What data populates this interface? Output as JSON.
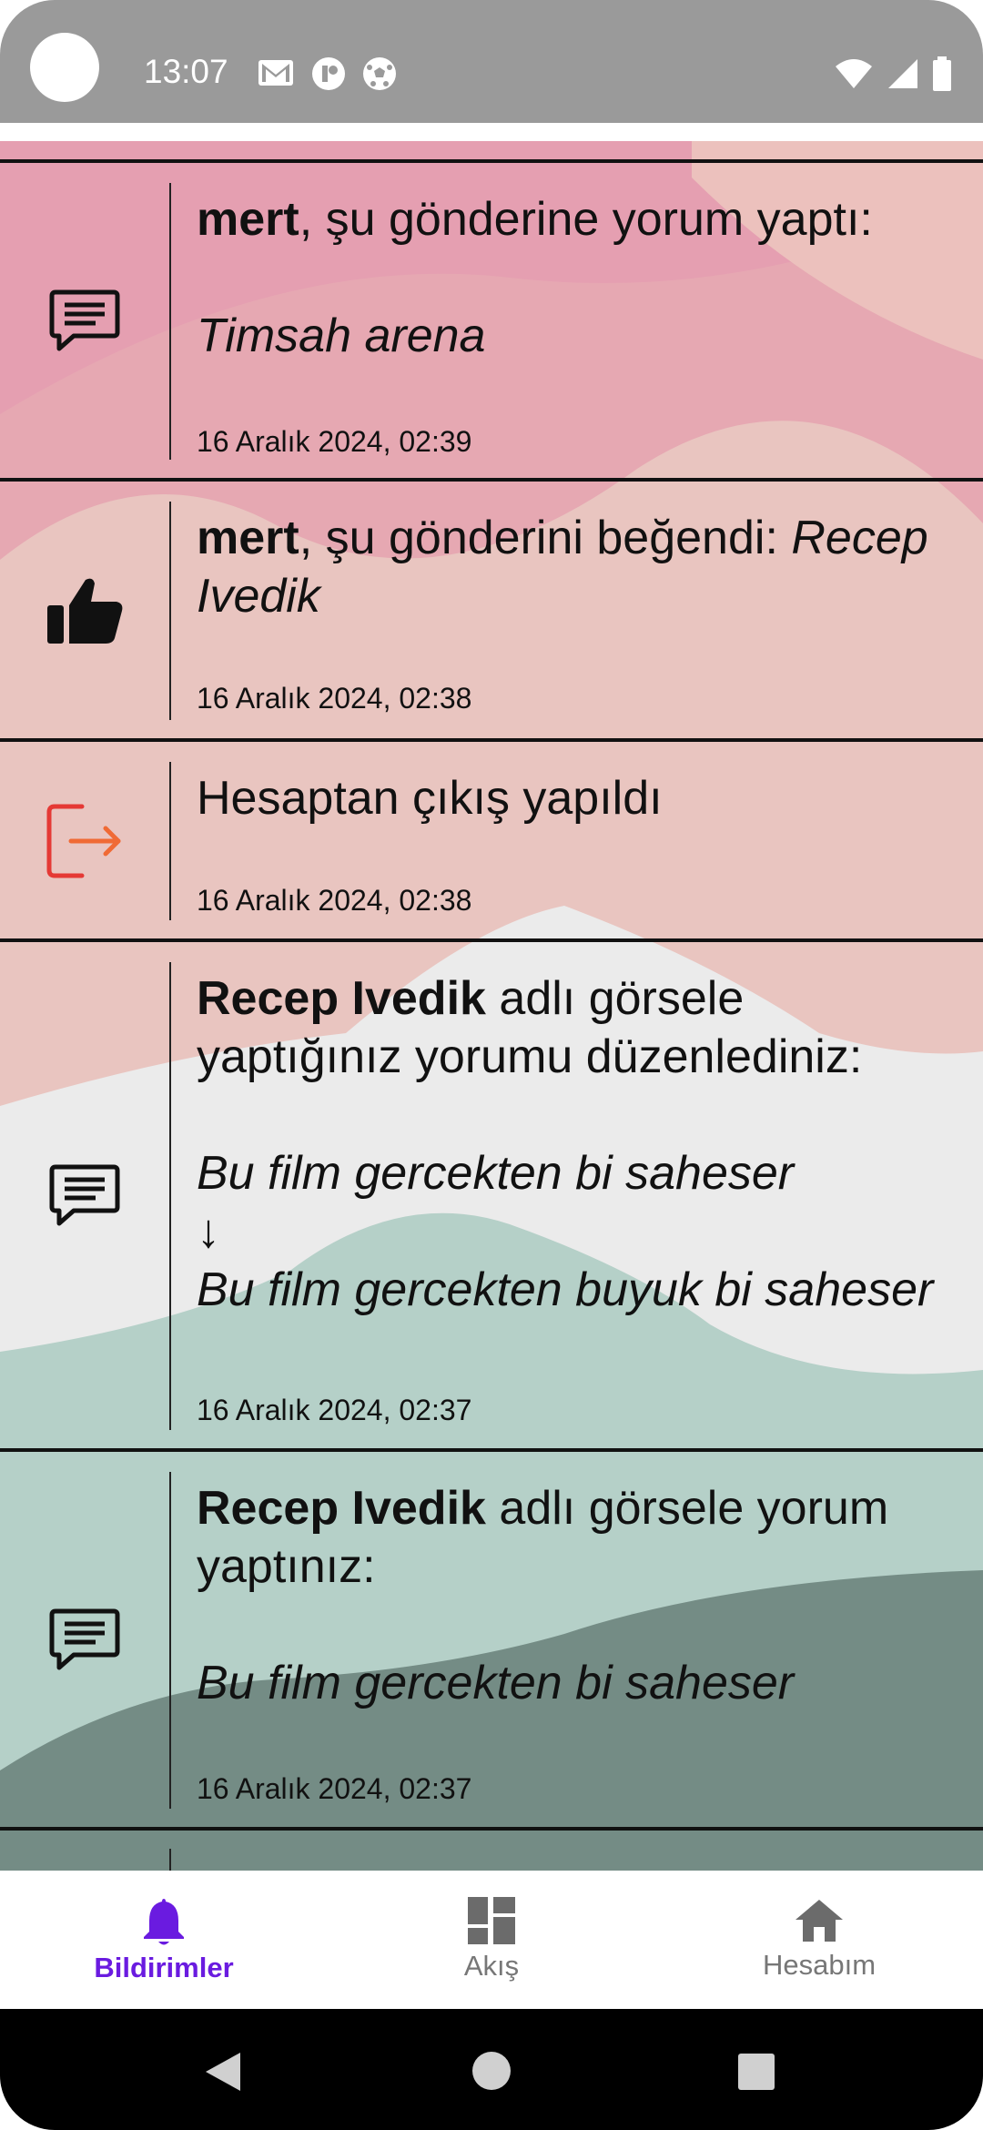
{
  "status_bar": {
    "time": "13:07"
  },
  "notifications": [
    {
      "icon": "comment-icon",
      "actor": "mert",
      "message": ", şu gönderine yorum yaptı:",
      "quote": "Timsah arena",
      "date": "16 Aralık 2024, 02:39"
    },
    {
      "icon": "thumbs-up-icon",
      "actor": "mert",
      "message": ", şu gönderini beğendi: ",
      "quote": "Recep Ivedik",
      "date": "16 Aralık 2024, 02:38"
    },
    {
      "icon": "logout-icon",
      "message": "Hesaptan çıkış yapıldı",
      "date": "16 Aralık 2024, 02:38"
    },
    {
      "icon": "comment-icon",
      "actor": "Recep Ivedik",
      "message": " adlı görsele yaptığınız yorumu düzenlediniz:",
      "old_comment": "Bu film gercekten bi saheser",
      "arrow": "↓",
      "new_comment": "Bu film gercekten buyuk bi saheser",
      "date": "16 Aralık 2024, 02:37"
    },
    {
      "icon": "comment-icon",
      "actor": "Recep Ivedik",
      "message": " adlı görsele yorum yaptınız:",
      "quote": "Bu film gercekten bi saheser",
      "date": "16 Aralık 2024, 02:37"
    }
  ],
  "bottom_nav": {
    "items": [
      {
        "label": "Bildirimler",
        "icon": "bell-icon",
        "active": true
      },
      {
        "label": "Akış",
        "icon": "dashboard-icon",
        "active": false
      },
      {
        "label": "Hesabım",
        "icon": "home-icon",
        "active": false
      }
    ]
  },
  "colors": {
    "accent": "#6a1be0",
    "logout_red": "#e53935"
  }
}
